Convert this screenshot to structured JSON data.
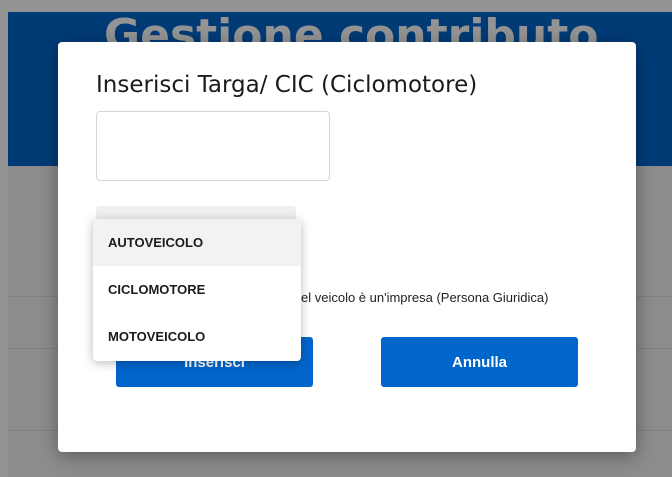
{
  "background": {
    "header_title": "Gestione contributo"
  },
  "modal": {
    "title": "Inserisci Targa/ CIC (Ciclomotore)",
    "plate_input": {
      "value": "",
      "placeholder": ""
    },
    "vehicle_type_select": {
      "selected_value": "AUTOVEICOLO",
      "options": [
        "AUTOVEICOLO",
        "CICLOMOTORE",
        "MOTOVEICOLO"
      ],
      "highlighted_option": "AUTOVEICOLO"
    },
    "company_owner_checkbox_label": "el veicolo è un'impresa (Persona Giuridica)",
    "insert_button_label": "Inserisci",
    "cancel_button_label": "Annulla"
  },
  "colors": {
    "accent": "#0066cc",
    "overlay": "rgba(0,0,0,0.42)",
    "option_highlight": "#f2f2f2"
  }
}
